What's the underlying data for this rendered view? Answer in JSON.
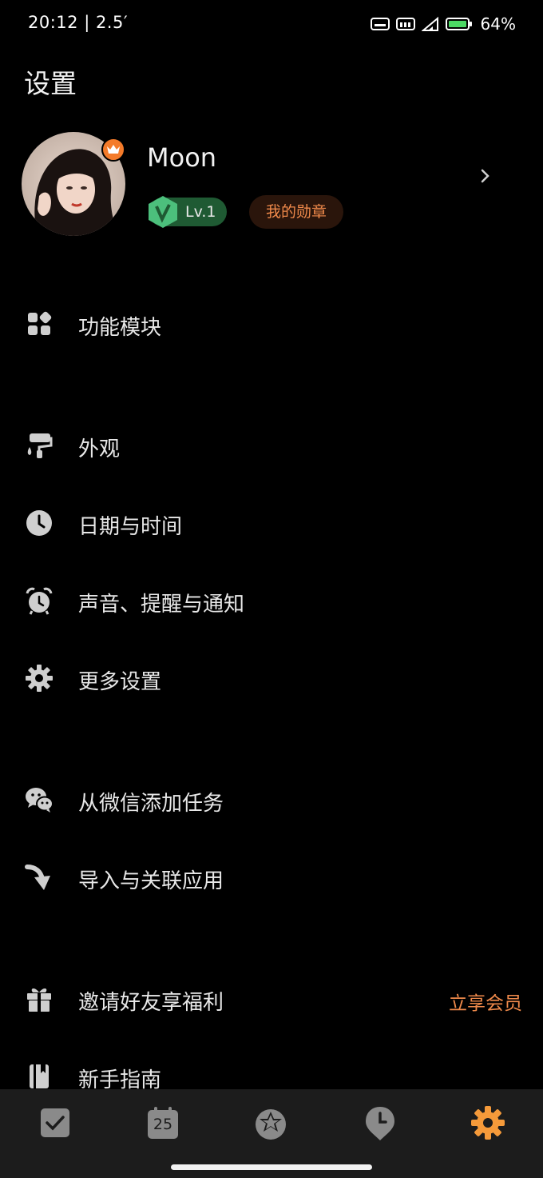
{
  "status": {
    "time": "20:12 | 2.5′",
    "battery": "64%"
  },
  "page": {
    "title": "设置"
  },
  "profile": {
    "name": "Moon",
    "level": "Lv.1",
    "medal": "我的勋章"
  },
  "menu": [
    {
      "label": "功能模块",
      "icon": "grid-icon"
    },
    {
      "label": "外观",
      "icon": "paint-roller-icon"
    },
    {
      "label": "日期与时间",
      "icon": "clock-icon"
    },
    {
      "label": "声音、提醒与通知",
      "icon": "alarm-icon"
    },
    {
      "label": "更多设置",
      "icon": "gear-icon"
    },
    {
      "label": "从微信添加任务",
      "icon": "wechat-icon"
    },
    {
      "label": "导入与关联应用",
      "icon": "import-arrow-icon"
    },
    {
      "label": "邀请好友享福利",
      "icon": "gift-icon",
      "extra": "立享会员"
    },
    {
      "label": "新手指南",
      "icon": "book-icon"
    }
  ],
  "tabs": [
    {
      "name": "tasks",
      "icon": "checkbox-icon"
    },
    {
      "name": "calendar",
      "icon": "calendar-icon",
      "text": "25"
    },
    {
      "name": "habits",
      "icon": "star-circle-icon"
    },
    {
      "name": "timer",
      "icon": "pin-clock-icon"
    },
    {
      "name": "settings",
      "icon": "gear-icon",
      "active": true
    }
  ],
  "colors": {
    "accent": "#f08a4b",
    "background": "#000000",
    "tab_bar": "#1c1c1c",
    "icon_gray": "#cfcfcf",
    "level_green": "#1f5a33"
  }
}
